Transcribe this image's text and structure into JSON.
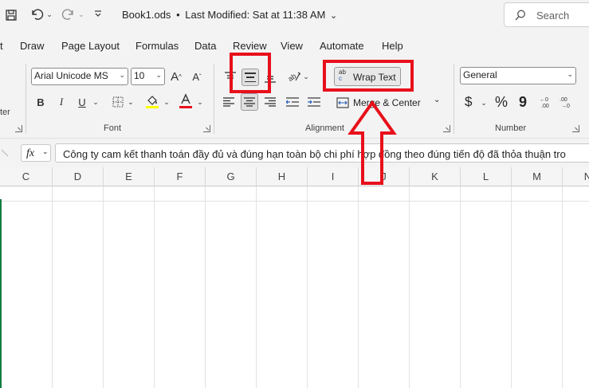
{
  "title": {
    "filename": "Book1.ods",
    "separator": "•",
    "modified": "Last Modified: Sat at 11:38 AM"
  },
  "search": {
    "placeholder": "Search"
  },
  "menu": [
    "t",
    "Draw",
    "Page Layout",
    "Formulas",
    "Data",
    "Review",
    "View",
    "Automate",
    "Help"
  ],
  "font": {
    "name": "Arial Unicode MS",
    "size": "10",
    "group_label": "Font",
    "left_clip": "ter"
  },
  "alignment": {
    "wrap_label": "Wrap Text",
    "merge_label": "Merge & Center",
    "group_label": "Alignment",
    "wrap_icon_top": "ab",
    "wrap_icon_bottom": "c"
  },
  "number": {
    "format": "General",
    "group_label": "Number",
    "currency": "$",
    "percent": "%",
    "comma": "9"
  },
  "formula": {
    "fx": "fx",
    "content": "Công ty cam kết thanh toán đầy đủ và đúng hạn toàn bộ chi phí hợp đồng theo đúng tiến độ đã thỏa thuận tro"
  },
  "columns": [
    "C",
    "D",
    "E",
    "F",
    "G",
    "H",
    "I",
    "J",
    "K",
    "L",
    "M",
    "N"
  ],
  "colors": {
    "highlight": "#e8101b",
    "font_color_bar": "#e8101b",
    "fill_color_bar": "#ffff00",
    "selection": "#107c41"
  }
}
